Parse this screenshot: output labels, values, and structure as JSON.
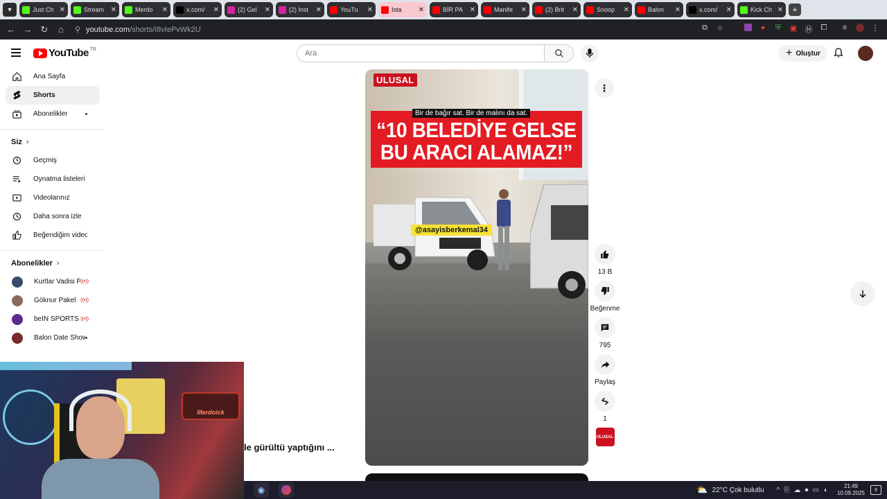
{
  "browser": {
    "tabs": [
      {
        "label": "Just Ch",
        "color": "#53fc18",
        "active": false
      },
      {
        "label": "Stream",
        "color": "#53fc18",
        "active": false
      },
      {
        "label": "Merdo",
        "color": "#53fc18",
        "active": false
      },
      {
        "label": "x.com/",
        "color": "#000000",
        "active": false
      },
      {
        "label": "(2) Gel",
        "color": "#d6249f",
        "active": false
      },
      {
        "label": "(2) Inst",
        "color": "#d6249f",
        "active": false
      },
      {
        "label": "YouTu",
        "color": "#ff0000",
        "active": false
      },
      {
        "label": "Ista",
        "color": "#ff0000",
        "active": true
      },
      {
        "label": "BİR PA",
        "color": "#ff0000",
        "active": false
      },
      {
        "label": "Manife",
        "color": "#ff0000",
        "active": false
      },
      {
        "label": "(2) Brit",
        "color": "#ff0000",
        "active": false
      },
      {
        "label": "Snoop",
        "color": "#ff0000",
        "active": false
      },
      {
        "label": "Balon",
        "color": "#ff0000",
        "active": false
      },
      {
        "label": "x.com/",
        "color": "#000000",
        "active": false
      },
      {
        "label": "Kick Ch",
        "color": "#53fc18",
        "active": false
      }
    ],
    "url_site": "youtube.com",
    "url_path": "/shorts/I8vIePvWk2U"
  },
  "header": {
    "logo_text": "YouTube",
    "country": "TR",
    "search_placeholder": "Ara",
    "create_label": "Oluştur"
  },
  "sidebar": {
    "main": [
      {
        "label": "Ana Sayfa",
        "icon": "home-icon"
      },
      {
        "label": "Shorts",
        "icon": "shorts-icon",
        "active": true
      },
      {
        "label": "Abonelikler",
        "icon": "subscriptions-icon",
        "dot": true
      }
    ],
    "you_title": "Siz",
    "you_items": [
      {
        "label": "Geçmiş",
        "icon": "history-icon"
      },
      {
        "label": "Oynatma listeleri",
        "icon": "playlists-icon"
      },
      {
        "label": "Videolarınız",
        "icon": "your-videos-icon"
      },
      {
        "label": "Daha sonra izle",
        "icon": "watch-later-icon"
      },
      {
        "label": "Beğendiğim videolar",
        "icon": "liked-icon"
      }
    ],
    "subs_title": "Abonelikler",
    "subs": [
      {
        "label": "Kurtlar Vadisi Pu...",
        "status": "live",
        "avatar": "#3b4a6b"
      },
      {
        "label": "Göknur Pakel",
        "status": "live",
        "avatar": "#8a6a5a"
      },
      {
        "label": "beIN SPORTS Tü...",
        "status": "live",
        "avatar": "#5b2d8a"
      },
      {
        "label": "Balon Date Show",
        "status": "dot",
        "avatar": "#7a2a2a"
      }
    ]
  },
  "video": {
    "channel_tag": "ULUSAL",
    "caption_small": "Bir de bağır sat. Bir de malını da sat.",
    "headline_line1": "“10 BELEDİYE GELSE",
    "headline_line2": "BU ARACI ALAMAZ!”",
    "handle": "@asayisberkemal34",
    "title_overlay": "le gürültü yaptığını ..."
  },
  "actions": {
    "likes": "13 B",
    "dislike_label": "Beğenme",
    "comments": "795",
    "share_label": "Paylaş",
    "remix_count": "1",
    "channel_badge": "ULUSAL"
  },
  "taskbar": {
    "weather": "22°C  Çok bulutlu",
    "time": "21:49",
    "date": "10.09.2025",
    "notifications": "9"
  },
  "webcam": {
    "sign_text": "Merdoick"
  }
}
